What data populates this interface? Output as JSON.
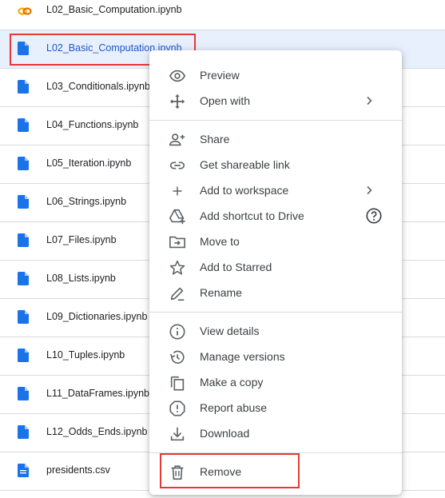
{
  "files": [
    {
      "name": "L02_Basic_Computation.ipynb",
      "type": "colab",
      "selected": false
    },
    {
      "name": "L02_Basic_Computation.ipynb",
      "type": "doc",
      "selected": true
    },
    {
      "name": "L03_Conditionals.ipynb",
      "type": "doc",
      "selected": false
    },
    {
      "name": "L04_Functions.ipynb",
      "type": "doc",
      "selected": false
    },
    {
      "name": "L05_Iteration.ipynb",
      "type": "doc",
      "selected": false
    },
    {
      "name": "L06_Strings.ipynb",
      "type": "doc",
      "selected": false
    },
    {
      "name": "L07_Files.ipynb",
      "type": "doc",
      "selected": false
    },
    {
      "name": "L08_Lists.ipynb",
      "type": "doc",
      "selected": false
    },
    {
      "name": "L09_Dictionaries.ipynb",
      "type": "doc",
      "selected": false
    },
    {
      "name": "L10_Tuples.ipynb",
      "type": "doc",
      "selected": false
    },
    {
      "name": "L11_DataFrames.ipynb",
      "type": "doc",
      "selected": false
    },
    {
      "name": "L12_Odds_Ends.ipynb",
      "type": "doc",
      "selected": false
    },
    {
      "name": "presidents.csv",
      "type": "sheet-doc",
      "selected": false
    }
  ],
  "menu": {
    "preview": "Preview",
    "open_with": "Open with",
    "share": "Share",
    "get_link": "Get shareable link",
    "add_workspace": "Add to workspace",
    "add_shortcut": "Add shortcut to Drive",
    "move_to": "Move to",
    "add_starred": "Add to Starred",
    "rename": "Rename",
    "view_details": "View details",
    "manage_versions": "Manage versions",
    "make_copy": "Make a copy",
    "report_abuse": "Report abuse",
    "download": "Download",
    "remove": "Remove"
  },
  "colors": {
    "doc_blue": "#4285f4",
    "colab_orange": "#f9ab00",
    "selected_bg": "#e8f0fe",
    "highlight_red": "#e53935"
  }
}
